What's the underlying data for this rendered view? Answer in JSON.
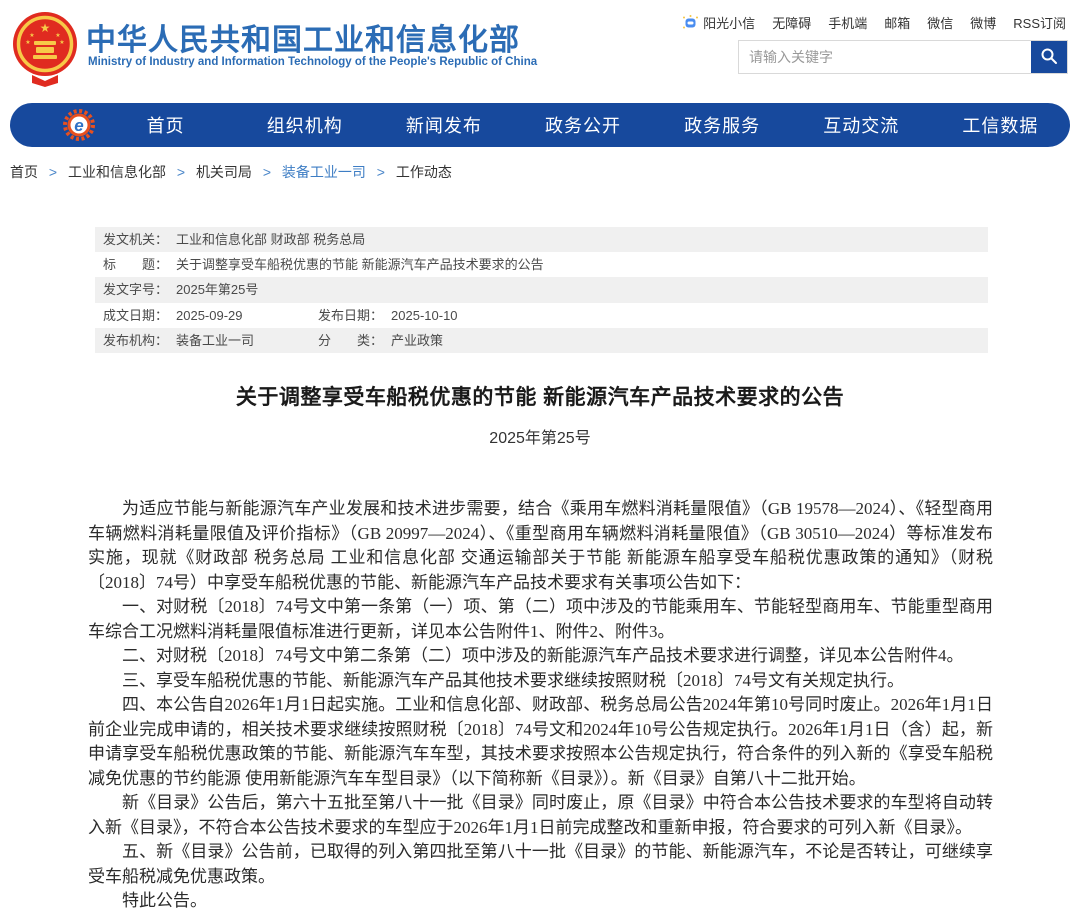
{
  "header": {
    "site_name": "中华人民共和国工业和信息化部",
    "site_name_en": "Ministry of Industry and Information Technology of the People's Republic of China",
    "top_links": [
      {
        "label": "阳光小信",
        "cls": "has-icon"
      },
      {
        "label": "无障碍"
      },
      {
        "label": "手机端"
      },
      {
        "label": "邮箱"
      },
      {
        "label": "微信"
      },
      {
        "label": "微博"
      },
      {
        "label": "RSS订阅"
      }
    ],
    "search": {
      "placeholder": "请输入关键字"
    }
  },
  "nav": {
    "items": [
      "首页",
      "组织机构",
      "新闻发布",
      "政务公开",
      "政务服务",
      "互动交流",
      "工信数据"
    ]
  },
  "breadcrumb": {
    "items": [
      {
        "label": "首页",
        "sep": ">"
      },
      {
        "label": "工业和信息化部",
        "sep": ">"
      },
      {
        "label": "机关司局",
        "sep": ">"
      },
      {
        "label": "装备工业一司",
        "sep": ">",
        "cls": "active"
      },
      {
        "label": "工作动态",
        "sep": ""
      }
    ]
  },
  "meta_table": {
    "rows": [
      {
        "label": "发文机关：",
        "value": "工业和信息化部 财政部 税务总局"
      },
      {
        "label": "标　　题：",
        "value": "关于调整享受车船税优惠的节能 新能源汽车产品技术要求的公告"
      },
      {
        "label": "发文字号：",
        "value": "2025年第25号"
      },
      {
        "label": "成文日期：",
        "value": "2025-09-29",
        "label2": "发布日期：",
        "value2": "2025-10-10",
        "cls": "two-col"
      },
      {
        "label": "发布机构：",
        "value": "装备工业一司",
        "label2": "分　　类：",
        "value2": "产业政策",
        "cls": "two-col"
      }
    ]
  },
  "document": {
    "title": "关于调整享受车船税优惠的节能 新能源汽车产品技术要求的公告",
    "doc_number": "2025年第25号",
    "paragraphs": [
      "为适应节能与新能源汽车产业发展和技术进步需要，结合《乘用车燃料消耗量限值》（GB 19578—2024）、《轻型商用车辆燃料消耗量限值及评价指标》（GB 20997—2024）、《重型商用车辆燃料消耗量限值》（GB 30510—2024）等标准发布实施，现就《财政部 税务总局 工业和信息化部 交通运输部关于节能 新能源车船享受车船税优惠政策的通知》（财税〔2018〕74号）中享受车船税优惠的节能、新能源汽车产品技术要求有关事项公告如下：",
      "一、对财税〔2018〕74号文中第一条第（一）项、第（二）项中涉及的节能乘用车、节能轻型商用车、节能重型商用车综合工况燃料消耗量限值标准进行更新，详见本公告附件1、附件2、附件3。",
      "二、对财税〔2018〕74号文中第二条第（二）项中涉及的新能源汽车产品技术要求进行调整，详见本公告附件4。",
      "三、享受车船税优惠的节能、新能源汽车产品其他技术要求继续按照财税〔2018〕74号文有关规定执行。",
      "四、本公告自2026年1月1日起实施。工业和信息化部、财政部、税务总局公告2024年第10号同时废止。2026年1月1日前企业完成申请的，相关技术要求继续按照财税〔2018〕74号文和2024年10号公告规定执行。2026年1月1日（含）起，新申请享受车船税优惠政策的节能、新能源汽车车型，其技术要求按照本公告规定执行，符合条件的列入新的《享受车船税减免优惠的节约能源 使用新能源汽车车型目录》（以下简称新《目录》）。新《目录》自第八十二批开始。",
      "新《目录》公告后，第六十五批至第八十一批《目录》同时废止，原《目录》中符合本公告技术要求的车型将自动转入新《目录》，不符合本公告技术要求的车型应于2026年1月1日前完成整改和重新申报，符合要求的可列入新《目录》。",
      "五、新《目录》公告前，已取得的列入第四批至第八十一批《目录》的节能、新能源汽车，不论是否转让，可继续享受车船税减免优惠政策。",
      "特此公告。"
    ]
  },
  "icons": {
    "emblem": "national-emblem",
    "nav_logo": "miit-gear-logo-icon",
    "mascot": "mascot-robot-icon",
    "search": "search-icon"
  },
  "colors": {
    "nav_blue": "#17499d",
    "title_blue": "#2b6cb5",
    "breadcrumb_link_blue": "#3d7dc4",
    "stripe_gray": "#f0f0f0",
    "emblem_red": "#e02b20",
    "emblem_gold": "#f7c948"
  }
}
